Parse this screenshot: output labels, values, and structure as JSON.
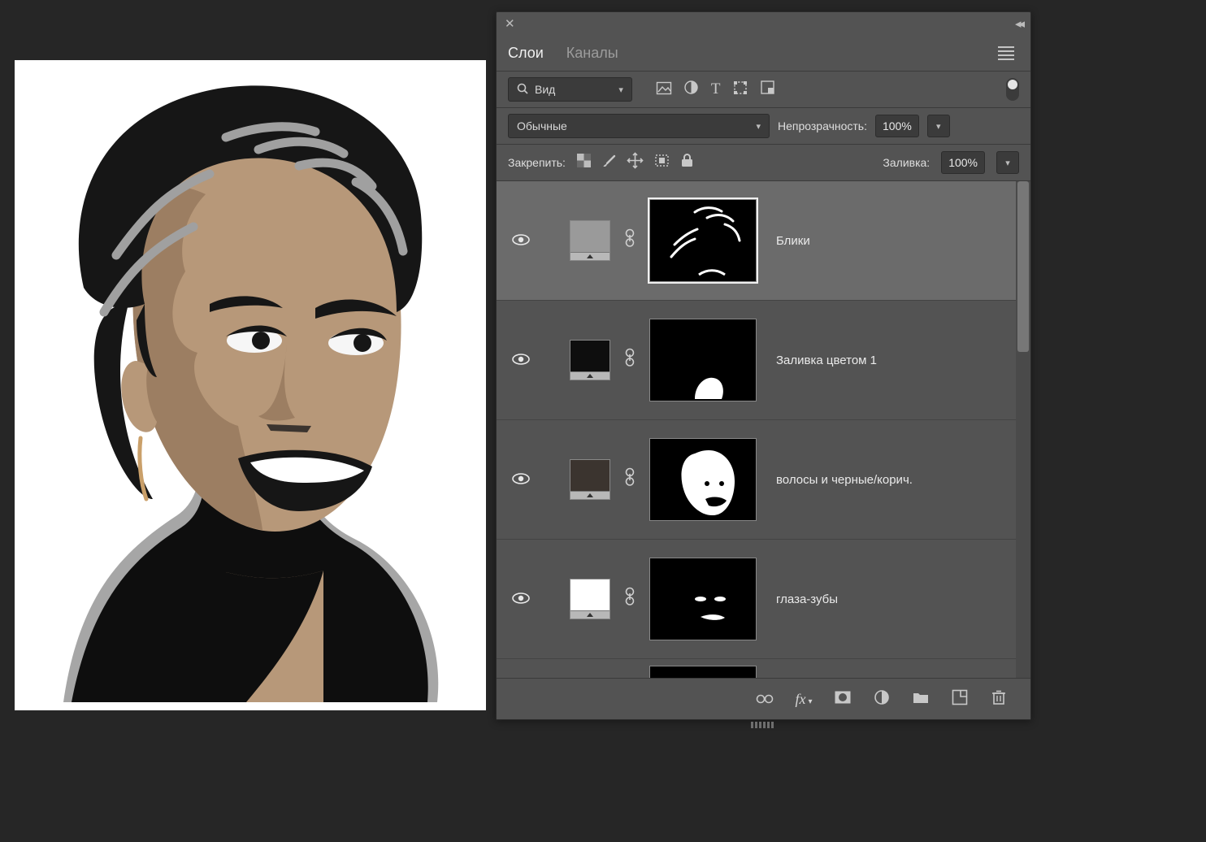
{
  "panel": {
    "tabs": {
      "layers": "Слои",
      "channels": "Каналы"
    },
    "filter": {
      "placeholder": "Вид"
    },
    "blend": {
      "mode": "Обычные",
      "opacity_label": "Непрозрачность:",
      "opacity_value": "100%"
    },
    "lock": {
      "label": "Закрепить:",
      "fill_label": "Заливка:",
      "fill_value": "100%"
    },
    "layers": [
      {
        "name": "Блики",
        "fill_swatch": "#9a9a9a",
        "selected": true
      },
      {
        "name": "Заливка цветом 1",
        "fill_swatch": "#0e0e0e",
        "selected": false
      },
      {
        "name": "волосы и черные/корич.",
        "fill_swatch": "#3b342f",
        "selected": false
      },
      {
        "name": "глаза-зубы",
        "fill_swatch": "#ffffff",
        "selected": false
      },
      {
        "name": "",
        "fill_swatch": "#ffffff",
        "selected": false
      }
    ]
  },
  "icons": {
    "close": "close-icon",
    "collapse": "collapse-icon",
    "search": "search-icon",
    "image": "image-filter-icon",
    "adjust": "adjustment-filter-icon",
    "type": "type-filter-icon",
    "shape": "shape-filter-icon",
    "smart": "smartobject-filter-icon",
    "lock_pixels": "lock-pixels-icon",
    "lock_brush": "lock-brush-icon",
    "lock_move": "lock-position-icon",
    "lock_artboard": "lock-artboard-icon",
    "lock_all": "lock-all-icon",
    "eye": "visibility-icon",
    "link": "link-icon",
    "b_link": "link-layers-icon",
    "b_fx": "fx-icon",
    "b_mask": "add-mask-icon",
    "b_adj": "new-adjustment-icon",
    "b_group": "new-group-icon",
    "b_new": "new-layer-icon",
    "b_trash": "delete-icon"
  }
}
